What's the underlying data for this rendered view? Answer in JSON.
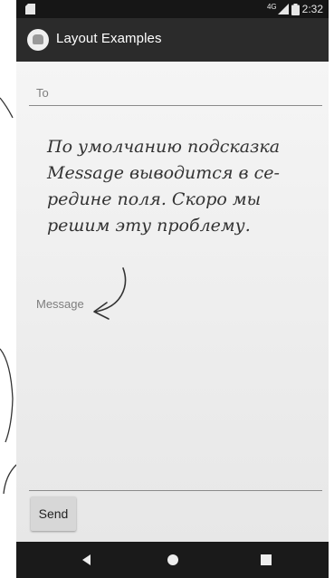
{
  "status_bar": {
    "time": "2:32",
    "network_label": "4G",
    "icons": [
      "sd-card-icon",
      "signal-icon",
      "battery-icon"
    ]
  },
  "action_bar": {
    "title": "Layout Examples",
    "icon": "app-logo-icon"
  },
  "form": {
    "to_hint": "To",
    "message_hint": "Message",
    "send_label": "Send"
  },
  "annotation": {
    "text": "По умолчанию подсказка\nMessage выводится в се-\nредине поля. Скоро мы\nрешим эту проблему."
  },
  "nav_bar": {
    "buttons": [
      "back-icon",
      "home-icon",
      "recents-icon"
    ]
  },
  "colors": {
    "status_bar": "#161616",
    "action_bar": "#2b2b2b",
    "content_background": "#f2f2f2",
    "nav_bar": "#1a1a1a",
    "button": "#d7d7d7"
  }
}
